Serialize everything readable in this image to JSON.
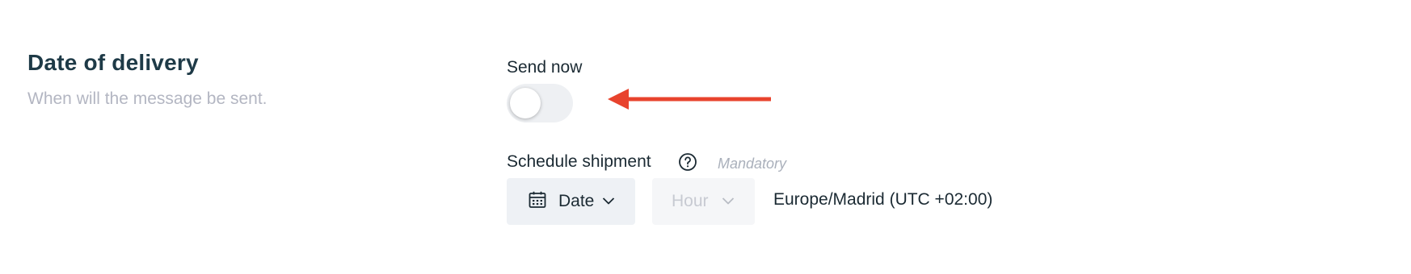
{
  "section": {
    "title": "Date of delivery",
    "description": "When will the message be sent."
  },
  "send_now": {
    "label": "Send now",
    "enabled": false
  },
  "schedule": {
    "label": "Schedule shipment",
    "mandatory_text": "Mandatory",
    "date_label": "Date",
    "hour_label": "Hour",
    "timezone": "Europe/Madrid (UTC +02:00)"
  },
  "icons": {
    "help": "question-circle-icon",
    "calendar": "calendar-icon",
    "chevron": "chevron-down-icon",
    "arrow": "arrow-left-icon"
  },
  "colors": {
    "annotation_arrow": "#e8432d",
    "title": "#1e3a47",
    "muted": "#b3b6c2"
  }
}
